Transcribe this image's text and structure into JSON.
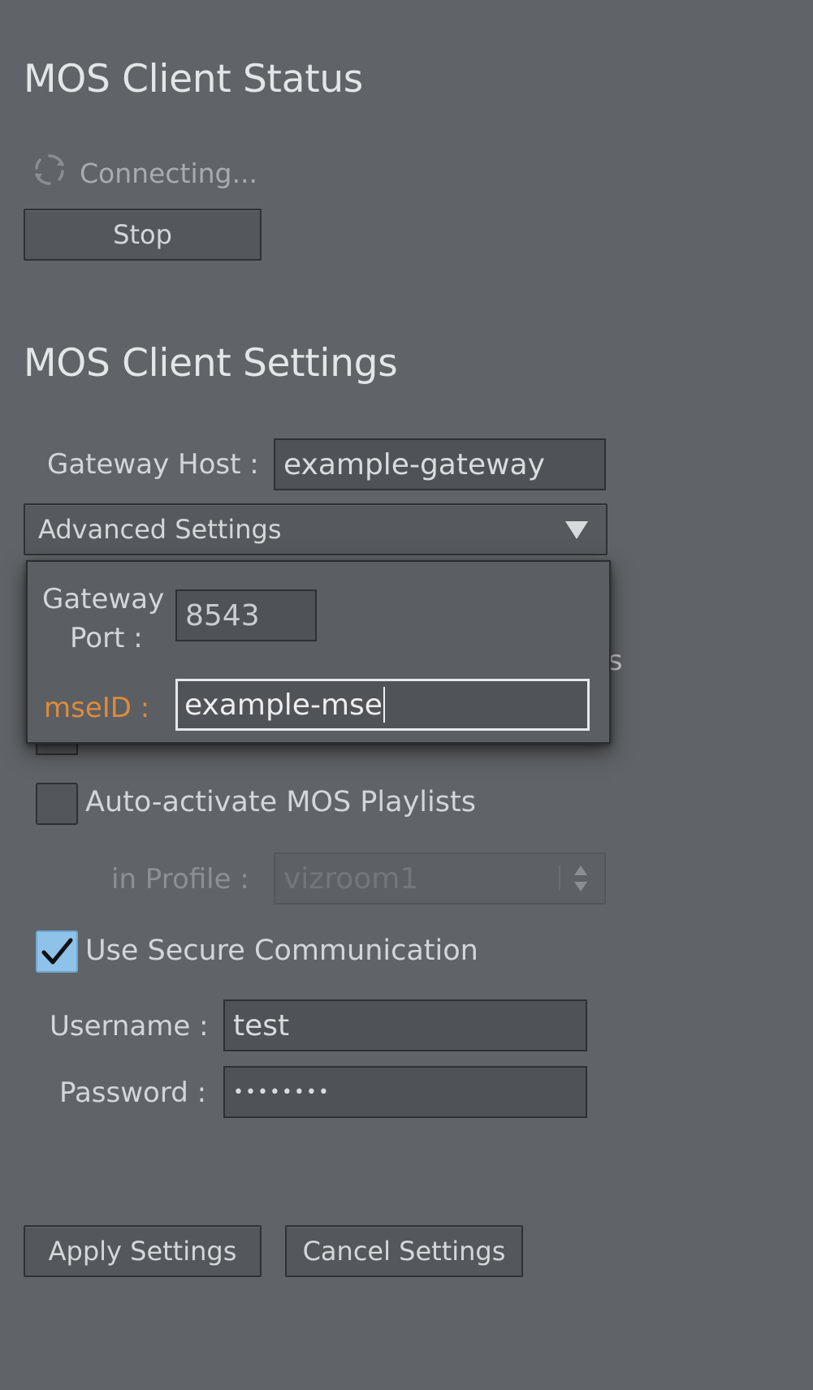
{
  "status": {
    "title": "MOS Client Status",
    "state_text": "Connecting...",
    "stop_label": "Stop"
  },
  "settings": {
    "title": "MOS Client Settings",
    "gateway_host_label": "Gateway Host :",
    "gateway_host_value": "example-gateway",
    "advanced_label": "Advanced Settings",
    "auto_activate_label": "Auto-activate MOS Playlists",
    "profile_label": "in Profile :",
    "profile_value": "vizroom1",
    "secure_label": "Use Secure Communication",
    "username_label": "Username :",
    "username_value": "test",
    "password_label": "Password :",
    "password_value": "••••••••",
    "apply_label": "Apply Settings",
    "cancel_label": "Cancel Settings"
  },
  "advanced_popup": {
    "gateway_port_label_line1": "Gateway",
    "gateway_port_label_line2": "Port :",
    "gateway_port_value": "8543",
    "mse_id_label": "mseID :",
    "mse_id_value": "example-mse"
  },
  "colors": {
    "background": "#606468",
    "focus_label": "#e08a3a",
    "checkbox_checked": "#8ec2e8",
    "focus_border": "#e6e9ec"
  },
  "icons": {
    "spinner": "refresh-icon",
    "dropdown": "triangle-down-icon",
    "stepper": "updown-arrows-icon",
    "check": "checkmark-icon"
  }
}
